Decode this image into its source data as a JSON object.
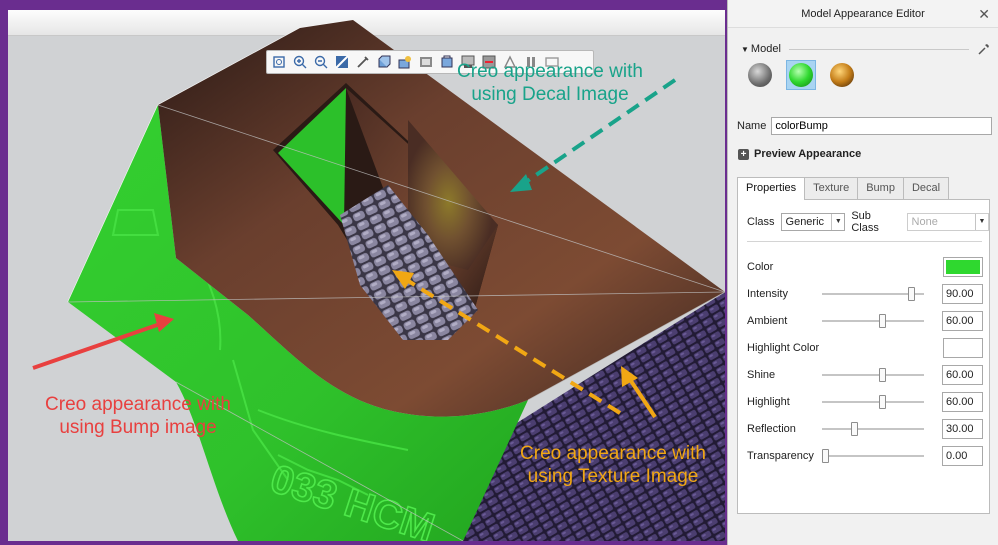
{
  "colors": {
    "frame": "#6a2d8f",
    "green_material": "#2fc12b",
    "callout_decal": "#19a38a",
    "callout_bump": "#e8403f",
    "callout_texture": "#f1a714",
    "selected_swatch": "#a9d4f2"
  },
  "viewport": {
    "toolbar_icons": [
      "refit-icon",
      "zoom-in-icon",
      "zoom-out-icon",
      "repaint-icon",
      "sketch-icon",
      "display-style-icon",
      "saved-views-icon",
      "view-manager-icon",
      "perspective-icon",
      "appearance-icon",
      "datum-display-icon",
      "annotation-display-icon",
      "spin-center-icon",
      "orient-icon"
    ],
    "callouts": {
      "decal": {
        "line1": "Creo appearance with",
        "line2": "using Decal Image"
      },
      "bump": {
        "line1": "Creo appearance with",
        "line2": "using Bump image"
      },
      "texture": {
        "line1": "Creo appearance with",
        "line2": "using Texture Image"
      }
    }
  },
  "panel": {
    "title": "Model Appearance Editor",
    "close_glyph": "✕",
    "section_label": "Model",
    "swatches": [
      {
        "name": "bump-appearance-swatch",
        "selected": false
      },
      {
        "name": "colorbump-appearance-swatch",
        "selected": true
      },
      {
        "name": "decal-appearance-swatch",
        "selected": false
      }
    ],
    "name_label": "Name",
    "name_value": "colorBump",
    "preview_label": "Preview Appearance",
    "tabs": [
      "Properties",
      "Texture",
      "Bump",
      "Decal"
    ],
    "active_tab": "Properties",
    "class_label": "Class",
    "class_value": "Generic",
    "subclass_label": "Sub Class",
    "subclass_value": "None",
    "properties": {
      "color_label": "Color",
      "color_value": "#2fd82f",
      "highlight_color_label": "Highlight Color",
      "highlight_color_value": "#ffffff",
      "sliders": [
        {
          "key": "intensity",
          "label": "Intensity",
          "value": "90.00",
          "fraction": 0.9
        },
        {
          "key": "ambient",
          "label": "Ambient",
          "value": "60.00",
          "fraction": 0.6
        },
        {
          "key": "shine",
          "label": "Shine",
          "value": "60.00",
          "fraction": 0.6
        },
        {
          "key": "highlight",
          "label": "Highlight",
          "value": "60.00",
          "fraction": 0.6
        },
        {
          "key": "reflection",
          "label": "Reflection",
          "value": "30.00",
          "fraction": 0.3
        },
        {
          "key": "transparency",
          "label": "Transparency",
          "value": "0.00",
          "fraction": 0.0
        }
      ]
    }
  }
}
